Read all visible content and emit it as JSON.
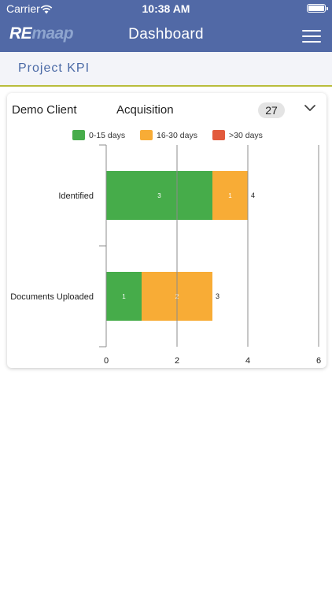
{
  "status_bar": {
    "carrier": "Carrier",
    "time": "10:38 AM"
  },
  "header": {
    "logo_re": "RE",
    "logo_rest": "maap",
    "title": "Dashboard"
  },
  "section": {
    "title": "Project KPI"
  },
  "card": {
    "client": "Demo Client",
    "category": "Acquisition",
    "count": "27"
  },
  "colors": {
    "nav": "#5169a6",
    "accent_line": "#b9bd3c",
    "green": "#46ac4a",
    "orange": "#f8ac36",
    "red": "#e25a3c"
  },
  "legend": [
    {
      "label": "0-15 days",
      "color": "#46ac4a"
    },
    {
      "label": "16-30 days",
      "color": "#f8ac36"
    },
    {
      "label": ">30 days",
      "color": "#e25a3c"
    }
  ],
  "chart_data": {
    "type": "bar",
    "orientation": "horizontal",
    "stacked": true,
    "categories": [
      "Identified",
      "Documents Uploaded"
    ],
    "series": [
      {
        "name": "0-15 days",
        "values": [
          3,
          1
        ],
        "color": "#46ac4a"
      },
      {
        "name": "16-30 days",
        "values": [
          1,
          2
        ],
        "color": "#f8ac36"
      },
      {
        "name": ">30 days",
        "values": [
          0,
          0
        ],
        "color": "#e25a3c"
      }
    ],
    "totals": [
      4,
      3
    ],
    "xlim": [
      0,
      6
    ],
    "xticks": [
      0,
      2,
      4,
      6
    ],
    "grid": true,
    "legend_position": "top"
  }
}
